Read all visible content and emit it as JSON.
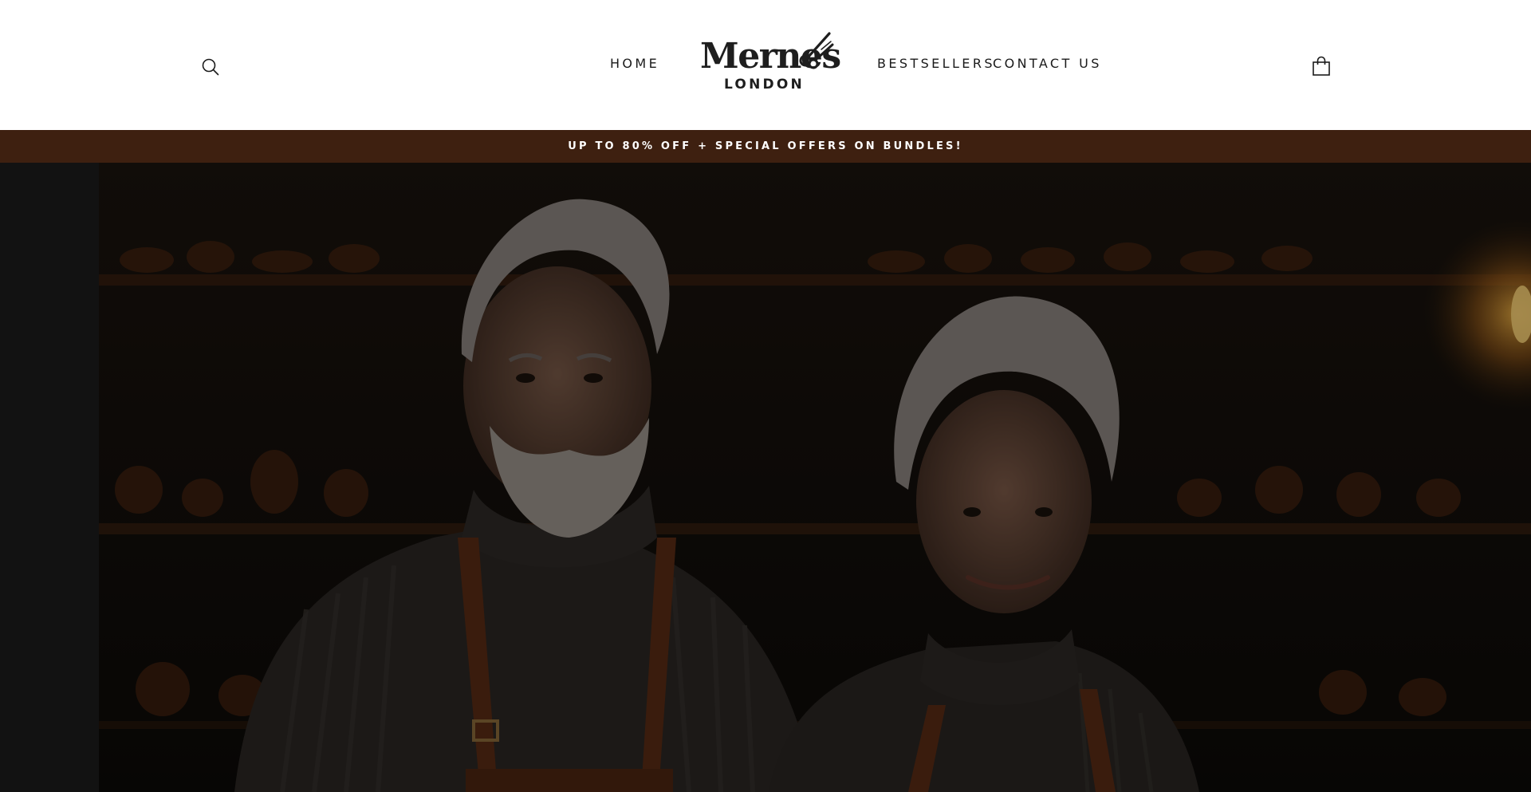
{
  "header": {
    "search_icon": "search-icon",
    "cart_icon": "shopping-bag-icon",
    "nav": {
      "home": "HOME",
      "bestsellers": "BESTSELLERS",
      "contact": "CONTACT US"
    },
    "logo": {
      "word": "Mernes",
      "sub": "LONDON",
      "mark_icon": "scissors-icon"
    }
  },
  "announcement": {
    "text": "UP TO 80% OFF + SPECIAL OFFERS ON BUNDLES!",
    "background": "#3e2010"
  },
  "hero": {
    "image_icon": "hero-photo-elderly-couple-cobblers"
  },
  "colors": {
    "text": "#1a1a1a",
    "brand_brown": "#3e2010",
    "leather": "#7a3f22"
  }
}
